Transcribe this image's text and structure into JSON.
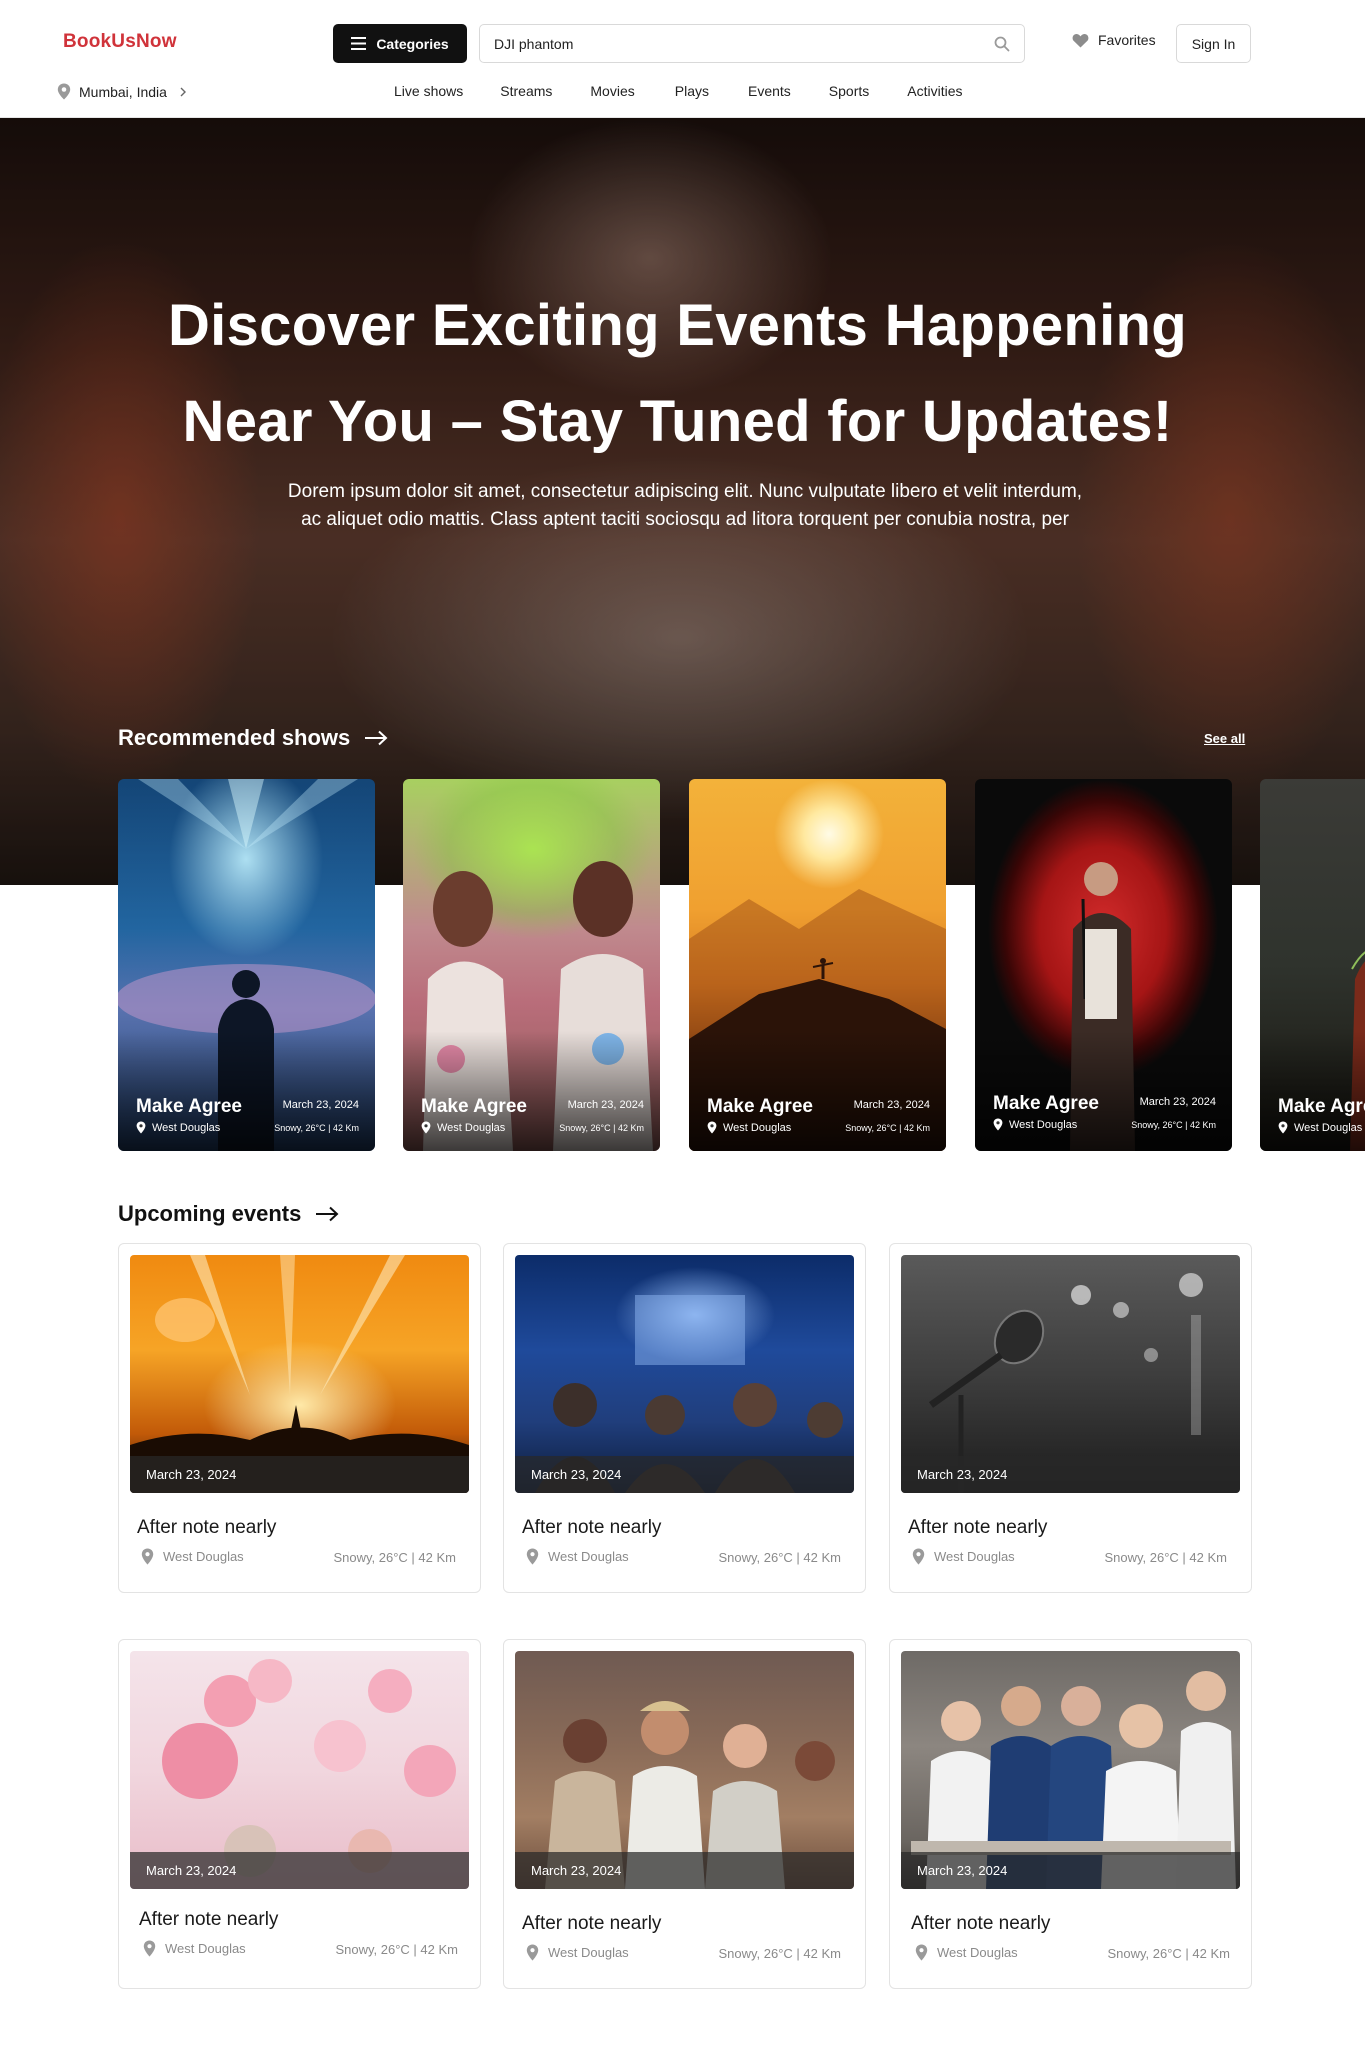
{
  "brand": {
    "name": "BookUsNow",
    "color": "#d0333a"
  },
  "header": {
    "categories_label": "Categories",
    "search_value": "DJI phantom",
    "favorites_label": "Favorites",
    "signin_label": "Sign In",
    "location": "Mumbai, India"
  },
  "nav": [
    "Live shows",
    "Streams",
    "Movies",
    "Plays",
    "Events",
    "Sports",
    "Activities"
  ],
  "hero": {
    "title_line1": "Discover Exciting Events Happening",
    "title_line2": "Near You – Stay Tuned for Updates!",
    "subtitle_line1": "Dorem ipsum dolor sit amet, consectetur adipiscing elit. Nunc vulputate libero et velit interdum,",
    "subtitle_line2": "ac aliquet odio mattis. Class aptent taciti sociosqu ad litora torquent per conubia nostra, per"
  },
  "recommended": {
    "heading": "Recommended shows",
    "see_all": "See all",
    "cards": [
      {
        "name": "Make Agree",
        "date": "March 23, 2024",
        "location": "West Douglas",
        "meta": "Snowy, 26°C | 42 Km",
        "image": "concert-stage-lights"
      },
      {
        "name": "Make Agree",
        "date": "March 23, 2024",
        "location": "West Douglas",
        "meta": "Snowy, 26°C | 42 Km",
        "image": "holi-color-festival"
      },
      {
        "name": "Make Agree",
        "date": "March 23, 2024",
        "location": "West Douglas",
        "meta": "Snowy, 26°C | 42 Km",
        "image": "sunset-mountain"
      },
      {
        "name": "Make Agree",
        "date": "March 23, 2024",
        "location": "West Douglas",
        "meta": "Snowy, 26°C | 42 Km",
        "image": "comedian-red-curtain"
      },
      {
        "name": "Make Agree",
        "date": "",
        "location": "West Douglas",
        "meta": "",
        "image": "performer-partial"
      }
    ]
  },
  "upcoming": {
    "heading": "Upcoming events",
    "events": [
      {
        "title": "After note nearly",
        "date": "March 23, 2024",
        "location": "West Douglas",
        "meta": "Snowy, 26°C | 42 Km",
        "image": "orange-concert"
      },
      {
        "title": "After note nearly",
        "date": "March 23, 2024",
        "location": "West Douglas",
        "meta": "Snowy, 26°C | 42 Km",
        "image": "conference-audience"
      },
      {
        "title": "After note nearly",
        "date": "March 23, 2024",
        "location": "West Douglas",
        "meta": "Snowy, 26°C | 42 Km",
        "image": "microphone-bw"
      },
      {
        "title": "After note nearly",
        "date": "March 23, 2024",
        "location": "West Douglas",
        "meta": "Snowy, 26°C | 42 Km",
        "image": "pink-balloons"
      },
      {
        "title": "After note nearly",
        "date": "March 23, 2024",
        "location": "West Douglas",
        "meta": "Snowy, 26°C | 42 Km",
        "image": "party-crowd"
      },
      {
        "title": "After note nearly",
        "date": "March 23, 2024",
        "location": "West Douglas",
        "meta": "Snowy, 26°C | 42 Km",
        "image": "catering-staff"
      }
    ]
  }
}
